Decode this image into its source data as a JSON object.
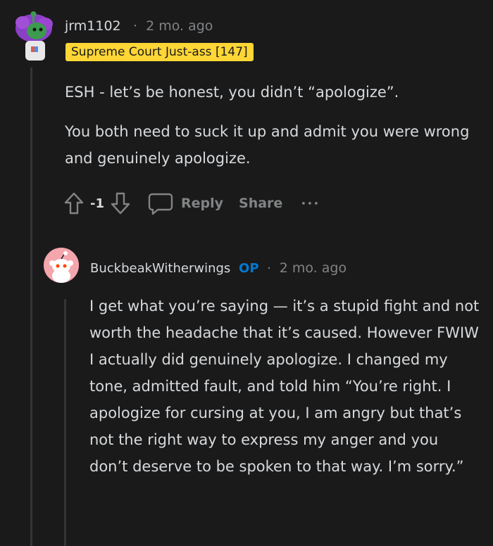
{
  "comment1": {
    "username": "jrm1102",
    "separator": "·",
    "time": "2 mo. ago",
    "flair": "Supreme Court Just-ass [147]",
    "paragraphs": [
      "ESH - let’s be honest, you didn’t “apologize”.",
      "You both need to suck it up and admit you were wrong and genuinely apologize."
    ],
    "score": "-1",
    "reply_label": "Reply",
    "share_label": "Share",
    "more_label": "•••"
  },
  "comment2": {
    "username": "BuckbeakWitherwings",
    "op_badge": "OP",
    "separator": "·",
    "time": "2 mo. ago",
    "body": "I get what you’re saying — it’s a stupid fight and not worth the headache that it’s caused. However FWIW I actually did genuinely apologize. I changed my tone, admitted fault, and told him “You’re right. I apologize for cursing at you, I am angry but that’s not the right way to express my anger and you don’t deserve to be spoken to that way. I’m sorry.”"
  },
  "icons": {
    "upvote": "arrow-up-icon",
    "downvote": "arrow-down-icon",
    "reply": "speech-bubble-icon",
    "more": "ellipsis-icon"
  },
  "colors": {
    "background": "#1a1a1b",
    "flair_bg": "#ffd635",
    "op_badge": "#0079d3",
    "muted": "#818384"
  }
}
